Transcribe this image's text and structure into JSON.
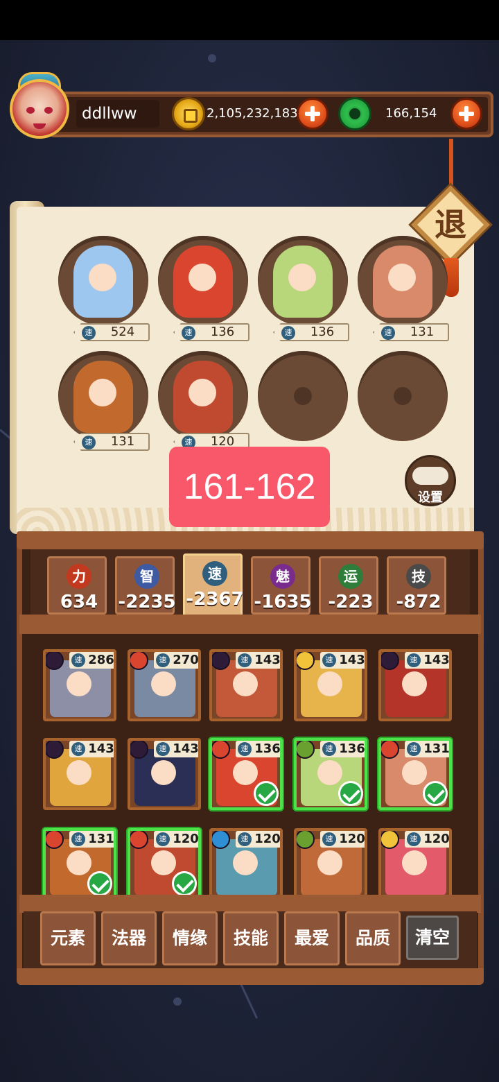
{
  "player": {
    "name": "ddllww"
  },
  "currency": {
    "gold": "2,105,232,183",
    "jade": "166,154"
  },
  "exit_label": "退",
  "team": [
    {
      "speed_badge": "速",
      "speed": "524",
      "color": "#9ec7ef"
    },
    {
      "speed_badge": "速",
      "speed": "136",
      "color": "#d9452e"
    },
    {
      "speed_badge": "速",
      "speed": "136",
      "color": "#b8d67a"
    },
    {
      "speed_badge": "速",
      "speed": "131",
      "color": "#d88a6a"
    },
    {
      "speed_badge": "速",
      "speed": "131",
      "color": "#c26a2e"
    },
    {
      "speed_badge": "速",
      "speed": "120",
      "color": "#c04a30"
    }
  ],
  "range_label": "161-162",
  "settings_label": "设置",
  "stats": [
    {
      "icon": "力",
      "value": "634",
      "color": "#c2391f"
    },
    {
      "icon": "智",
      "value": "-2235",
      "color": "#3e5aa3"
    },
    {
      "icon": "速",
      "value": "-2367",
      "color": "#2f5f7d",
      "active": true
    },
    {
      "icon": "魅",
      "value": "-1635",
      "color": "#7a2c8e"
    },
    {
      "icon": "运",
      "value": "-223",
      "color": "#2f7d3a"
    },
    {
      "icon": "技",
      "value": "-872",
      "color": "#4a4a4a"
    }
  ],
  "cards": [
    {
      "speed_badge": "速",
      "speed": "286",
      "element_color": "#2d1b38",
      "art": "#8d8fa6",
      "selected": false
    },
    {
      "speed_badge": "速",
      "speed": "270",
      "element_color": "#d9452e",
      "art": "#7b8aa3",
      "selected": false
    },
    {
      "speed_badge": "速",
      "speed": "143",
      "element_color": "#2d1b38",
      "art": "#c4593a",
      "selected": false
    },
    {
      "speed_badge": "速",
      "speed": "143",
      "element_color": "#f1c33a",
      "art": "#e6b44a",
      "selected": false
    },
    {
      "speed_badge": "速",
      "speed": "143",
      "element_color": "#2d1b38",
      "art": "#b5342a",
      "selected": false
    },
    {
      "speed_badge": "速",
      "speed": "143",
      "element_color": "#2d1b38",
      "art": "#e0a53c",
      "selected": false
    },
    {
      "speed_badge": "速",
      "speed": "143",
      "element_color": "#2d1b38",
      "art": "#2b2f55",
      "selected": false
    },
    {
      "speed_badge": "速",
      "speed": "136",
      "element_color": "#d9452e",
      "art": "#d9452e",
      "selected": true
    },
    {
      "speed_badge": "速",
      "speed": "136",
      "element_color": "#6aa030",
      "art": "#b8d67a",
      "selected": true
    },
    {
      "speed_badge": "速",
      "speed": "131",
      "element_color": "#d9452e",
      "art": "#d88a6a",
      "selected": true
    },
    {
      "speed_badge": "速",
      "speed": "131",
      "element_color": "#d9452e",
      "art": "#c26a2e",
      "selected": true
    },
    {
      "speed_badge": "速",
      "speed": "120",
      "element_color": "#d9452e",
      "art": "#c04a30",
      "selected": true
    },
    {
      "speed_badge": "速",
      "speed": "120",
      "element_color": "#2f8fd4",
      "art": "#5a9bb0",
      "selected": false
    },
    {
      "speed_badge": "速",
      "speed": "120",
      "element_color": "#6aa030",
      "art": "#c06a3a",
      "selected": false
    },
    {
      "speed_badge": "速",
      "speed": "120",
      "element_color": "#f1c33a",
      "art": "#e35a6a",
      "selected": false
    }
  ],
  "filters": [
    "元素",
    "法器",
    "情缘",
    "技能",
    "最爱",
    "品质"
  ],
  "clear_label": "清空"
}
